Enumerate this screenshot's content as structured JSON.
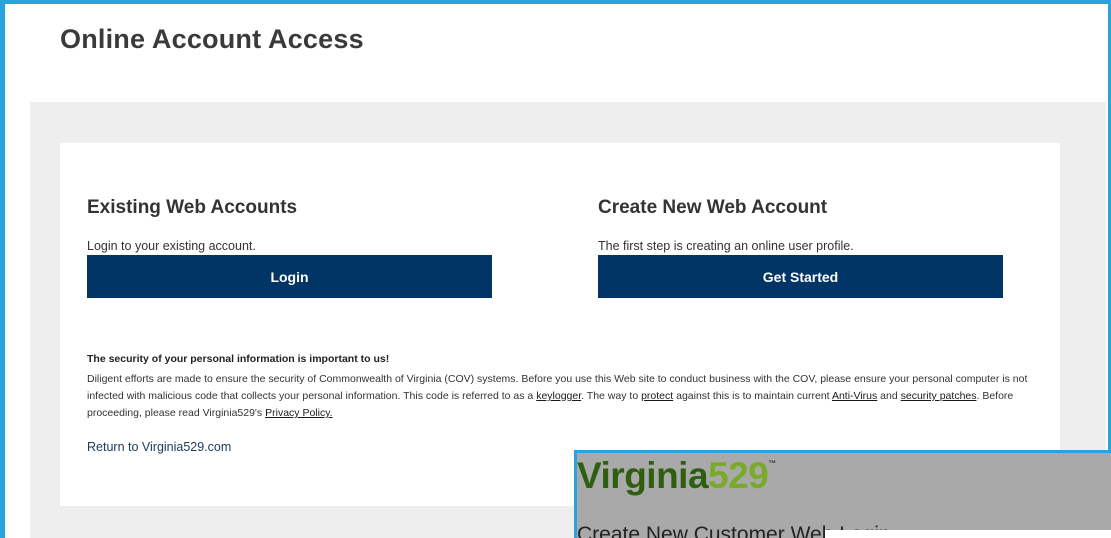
{
  "page": {
    "title": "Online Account Access"
  },
  "existing": {
    "heading": "Existing Web Accounts",
    "subtext": "Login to your existing account.",
    "button_label": "Login"
  },
  "create": {
    "heading": "Create New Web Account",
    "subtext": "The first step is creating an online user profile.",
    "button_label": "Get Started"
  },
  "security": {
    "heading": "The security of your personal information is important to us!",
    "text_1": "Diligent efforts are made to ensure the security of Commonwealth of Virginia (COV) systems. Before you use this Web site to conduct business with the COV, please ensure your personal computer is not infected with malicious code that collects your personal information. This code is referred to as a ",
    "link_keylogger": "keylogger",
    "text_2": ". The way to ",
    "link_protect": "protect",
    "text_3": " against this is to maintain current ",
    "link_antivirus": "Anti-Virus",
    "text_4": " and ",
    "link_patches": "security patches",
    "text_5": ". Before proceeding, please read Virginia529's ",
    "link_privacy": "Privacy Policy."
  },
  "footer": {
    "return_link": "Return to Virginia529.com"
  },
  "overlay": {
    "logo_word": "Virginia",
    "logo_number": "529",
    "logo_tm": "™",
    "subtitle": "Create New Customer Web Login"
  },
  "colors": {
    "button_bg": "#003566",
    "frame_accent": "#2aa3dc",
    "logo_green": "#7aaa2a"
  }
}
